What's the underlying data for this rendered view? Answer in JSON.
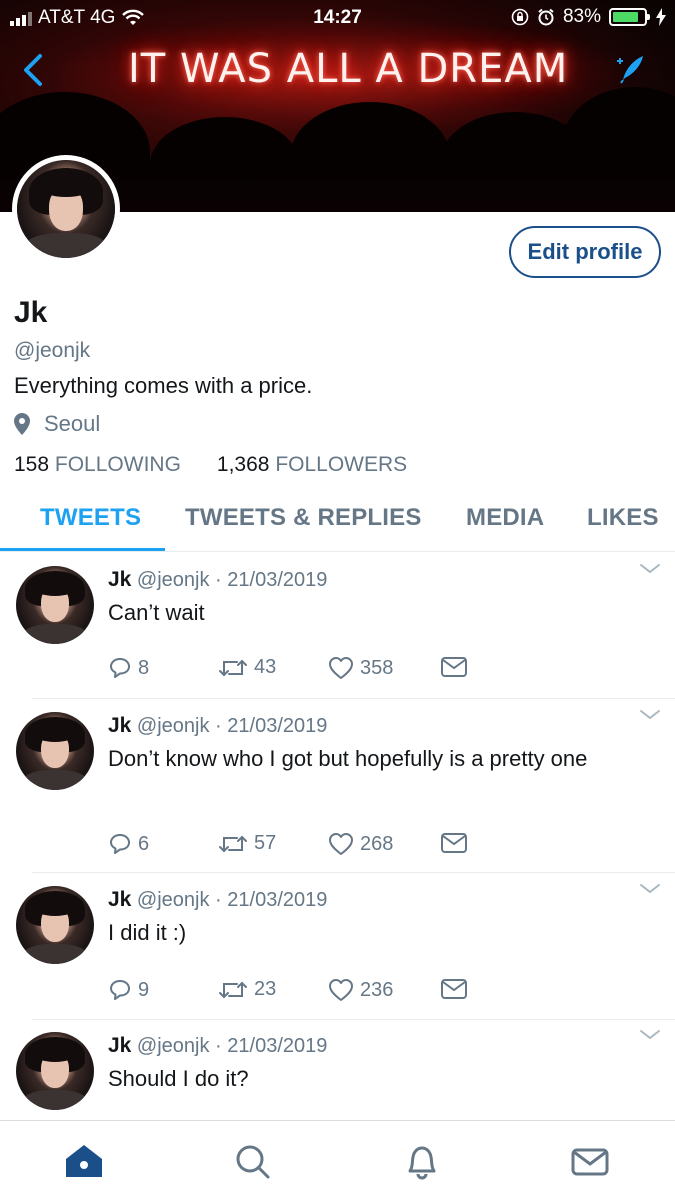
{
  "status_bar": {
    "carrier": "AT&T 4G",
    "time": "14:27",
    "battery": "83%",
    "battery_level": 0.83
  },
  "banner": {
    "neon_text": "IT WAS ALL A DREAM"
  },
  "profile": {
    "edit_button": "Edit profile",
    "name": "Jk",
    "handle": "@jeonjk",
    "bio": "Everything comes with a price.",
    "location": "Seoul",
    "following_count": "158",
    "following_label": "FOLLOWING",
    "followers_count": "1,368",
    "followers_label": "FOLLOWERS"
  },
  "tabs": [
    {
      "label": "TWEETS",
      "active": true
    },
    {
      "label": "TWEETS & REPLIES",
      "active": false
    },
    {
      "label": "MEDIA",
      "active": false
    },
    {
      "label": "LIKES",
      "active": false
    }
  ],
  "tweets": [
    {
      "name": "Jk",
      "handle": "@jeonjk",
      "date": "· 21/03/2019",
      "text": "Can’t wait",
      "replies": "8",
      "retweets": "43",
      "likes": "358"
    },
    {
      "name": "Jk",
      "handle": "@jeonjk",
      "date": "· 21/03/2019",
      "text": "Don’t know who I got but hopefully is a pretty one",
      "replies": "6",
      "retweets": "57",
      "likes": "268"
    },
    {
      "name": "Jk",
      "handle": "@jeonjk",
      "date": "· 21/03/2019",
      "text": "I did it :)",
      "replies": "9",
      "retweets": "23",
      "likes": "236"
    },
    {
      "name": "Jk",
      "handle": "@jeonjk",
      "date": "· 21/03/2019",
      "text": "Should I do it?",
      "replies": "",
      "retweets": "",
      "likes": ""
    }
  ],
  "bottom_nav": [
    {
      "icon": "home-icon",
      "active": true
    },
    {
      "icon": "search-icon",
      "active": false
    },
    {
      "icon": "bell-icon",
      "active": false
    },
    {
      "icon": "mail-icon",
      "active": false
    }
  ],
  "colors": {
    "accent": "#1da1f2",
    "secondary_text": "#657786",
    "edit_border": "#1b4f8a",
    "nav_active": "#1b4f8a",
    "battery_green": "#4cd964"
  }
}
